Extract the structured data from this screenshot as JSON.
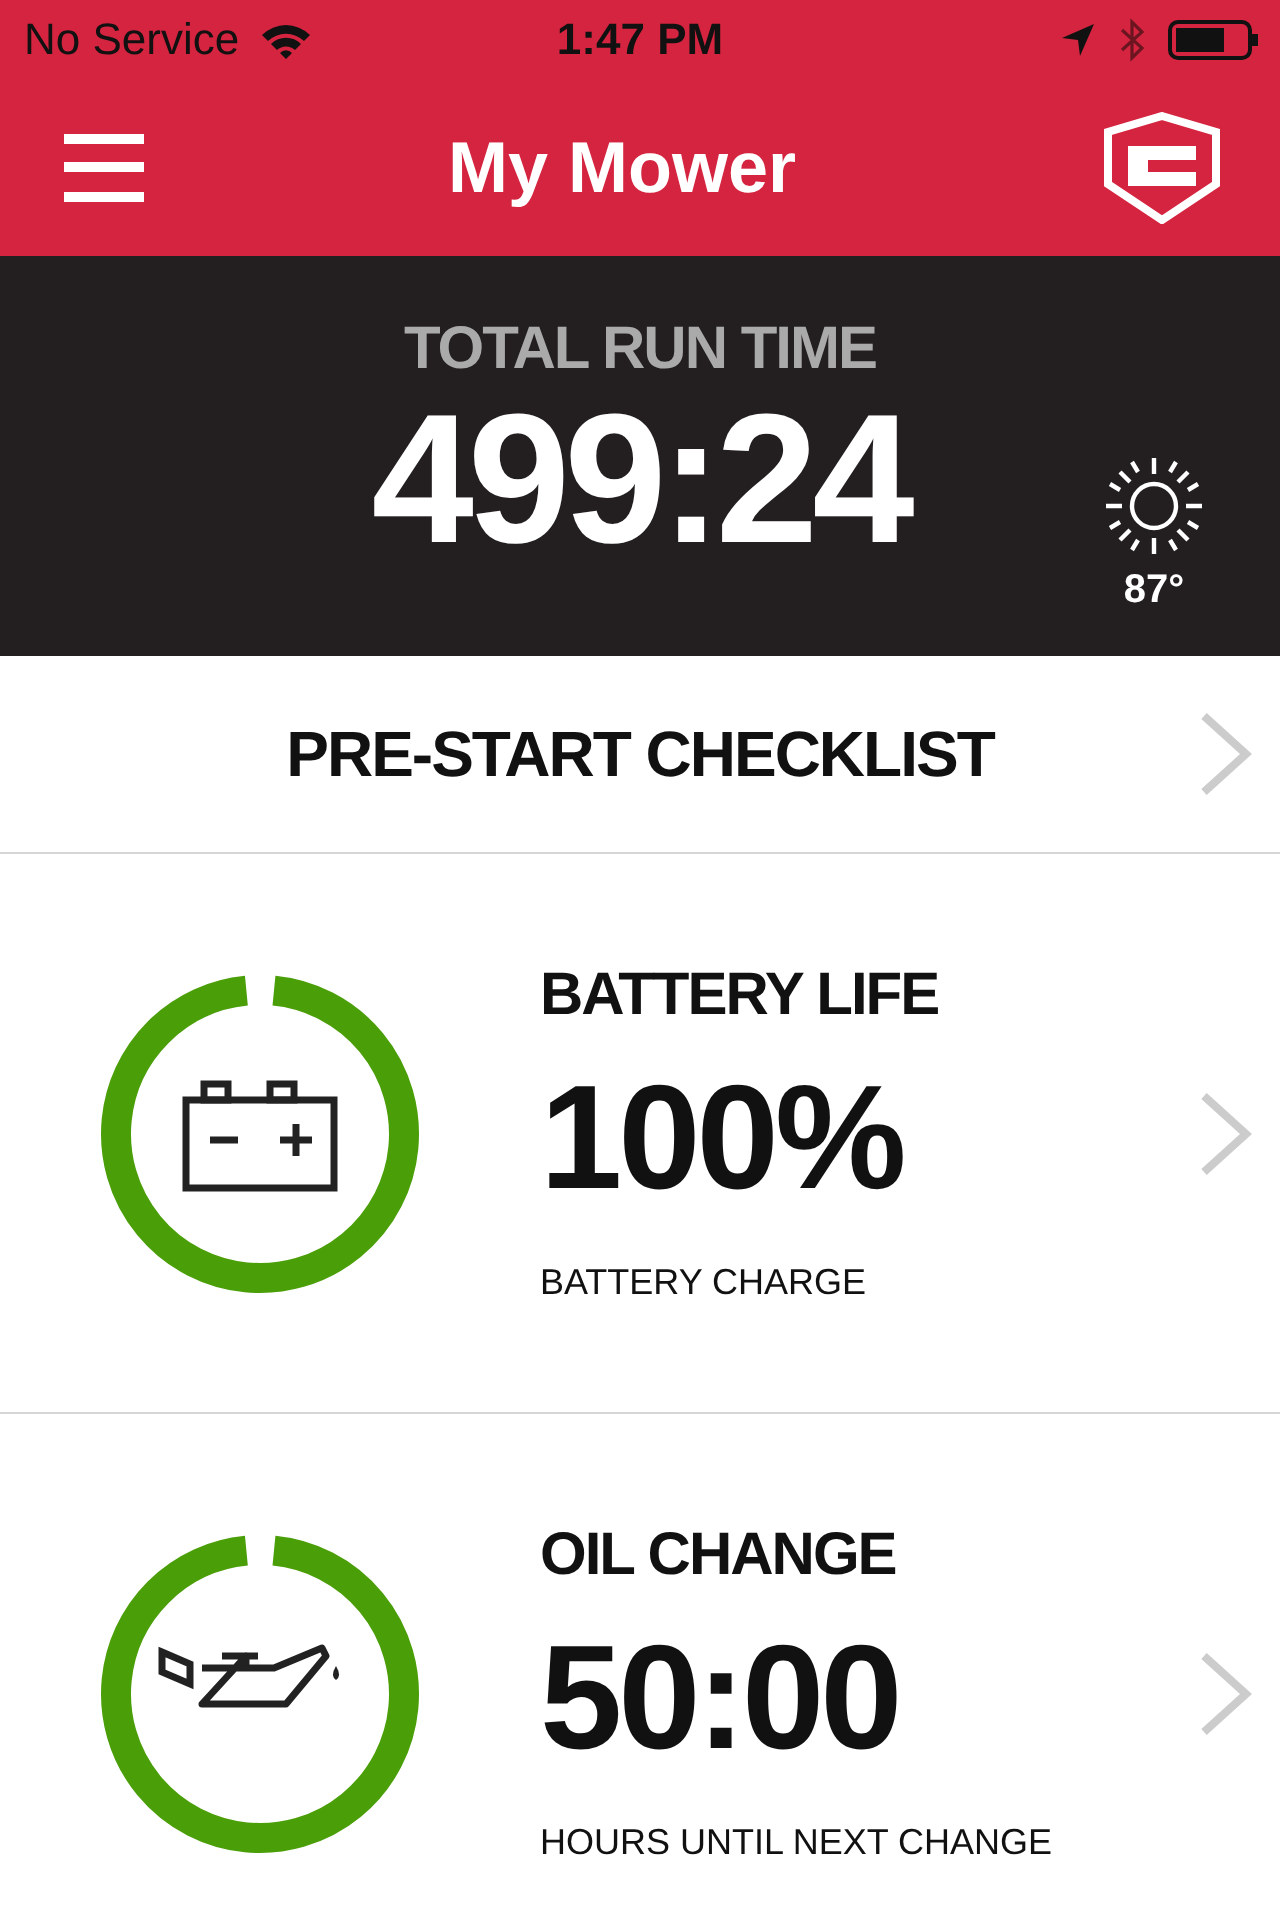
{
  "status_bar": {
    "carrier": "No Service",
    "time": "1:47 PM"
  },
  "header": {
    "title": "My Mower"
  },
  "run_time": {
    "label": "TOTAL RUN TIME",
    "value": "499:24",
    "temperature": "87°"
  },
  "checklist": {
    "label": "PRE-START CHECKLIST"
  },
  "gauges": [
    {
      "kind": "battery",
      "title": "BATTERY LIFE",
      "value": "100%",
      "caption": "BATTERY CHARGE",
      "level": 1
    },
    {
      "kind": "oil",
      "title": "OIL CHANGE",
      "value": "50:00",
      "caption": "HOURS UNTIL NEXT CHANGE",
      "level": 1
    }
  ]
}
